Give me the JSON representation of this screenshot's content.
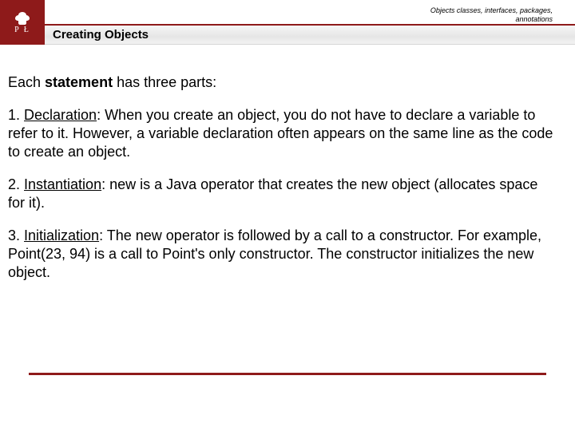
{
  "header": {
    "breadcrumb_line1": "Objects classes, interfaces, packages,",
    "breadcrumb_line2": "annotations",
    "logo_letters": "P   Ł",
    "title": "Creating Objects"
  },
  "body": {
    "intro_pre": "Each ",
    "intro_bold": "statement",
    "intro_post": " has three parts:",
    "items": [
      {
        "num": "1. ",
        "term": "Declaration",
        "rest": ": When you create an object, you do not have to declare a variable to refer to it. However, a variable declaration often appears on the same line as the code to create an object."
      },
      {
        "num": "2. ",
        "term": "Instantiation",
        "rest": ": new is a Java operator that creates the new object (allocates space for it)."
      },
      {
        "num": "3. ",
        "term": "Initialization",
        "rest": ": The new operator is followed by a call to a constructor. For example, Point(23, 94) is a call to Point's only constructor. The constructor initializes the new object."
      }
    ]
  }
}
